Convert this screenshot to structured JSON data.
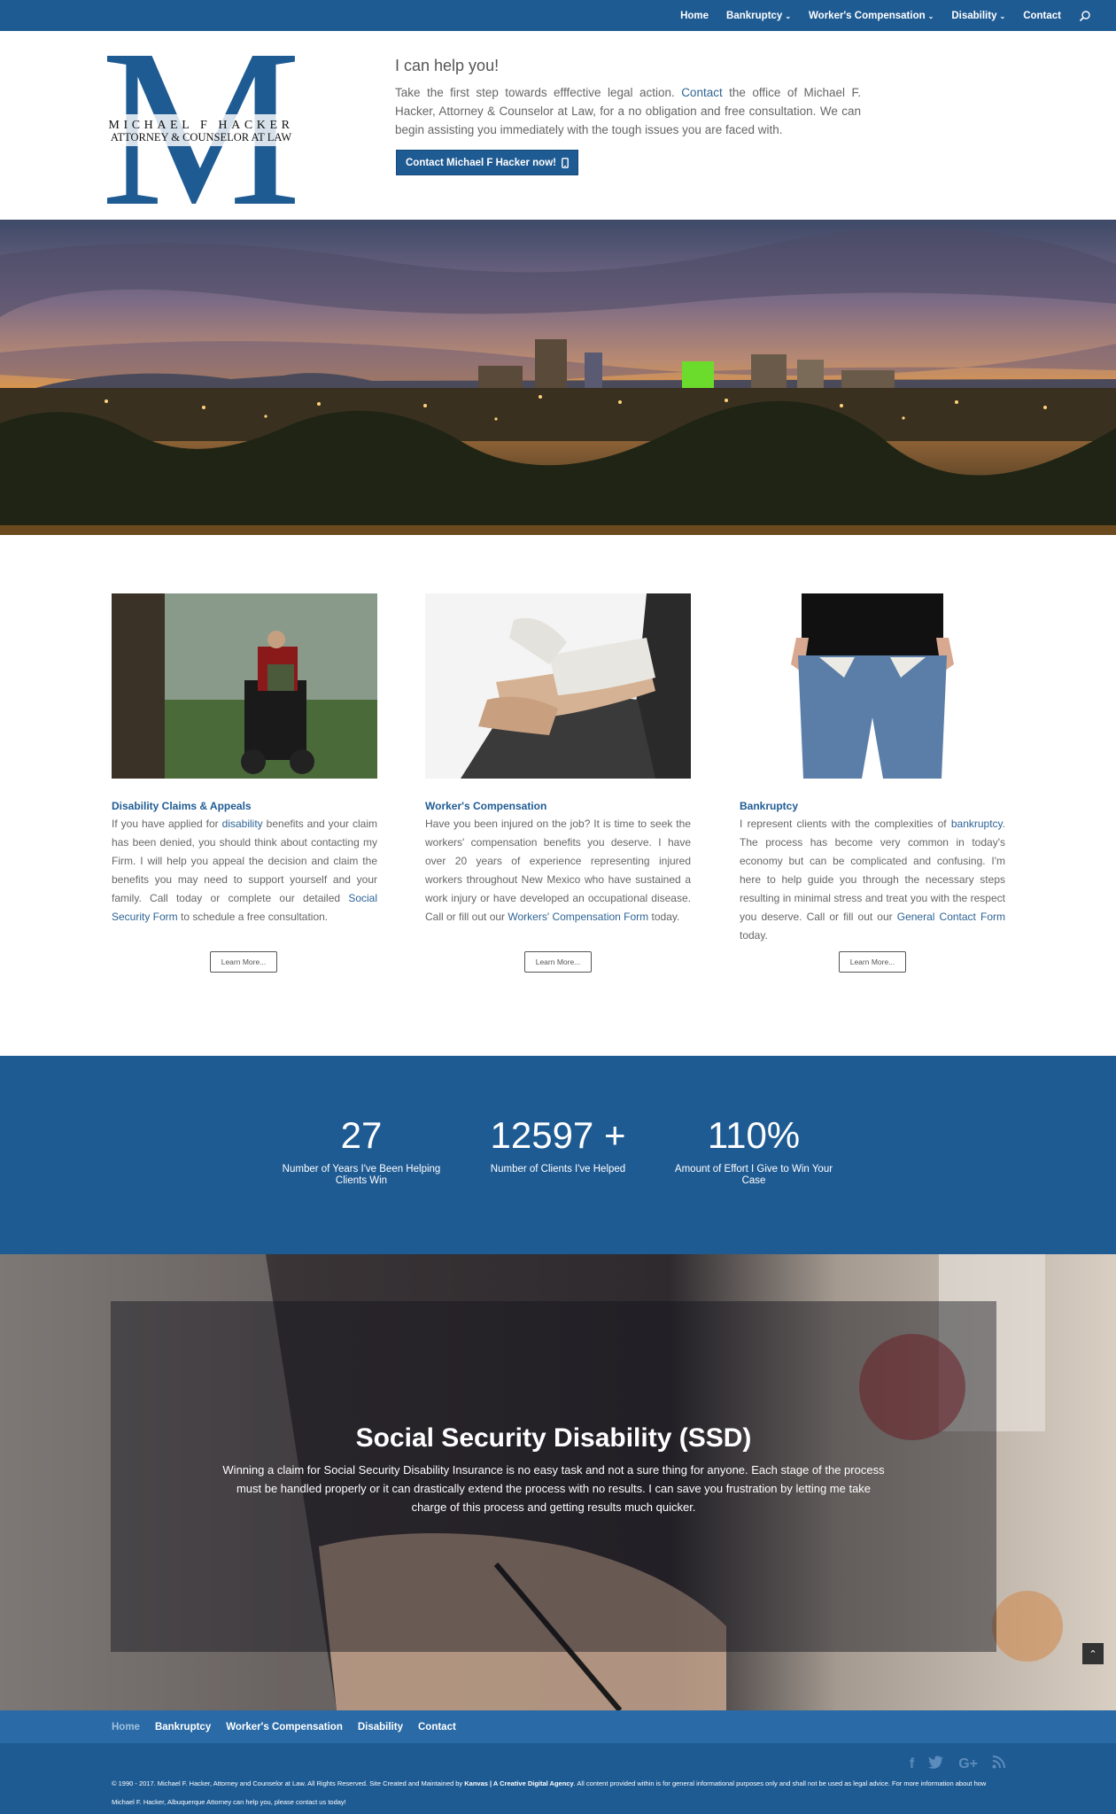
{
  "nav": {
    "items": [
      {
        "label": "Home",
        "dropdown": false
      },
      {
        "label": "Bankruptcy",
        "dropdown": true
      },
      {
        "label": "Worker's Compensation",
        "dropdown": true
      },
      {
        "label": "Disability",
        "dropdown": true
      },
      {
        "label": "Contact",
        "dropdown": false
      }
    ]
  },
  "logo": {
    "monogram": "M",
    "line1": "MICHAEL F HACKER",
    "line2": "ATTORNEY & COUNSELOR AT LAW"
  },
  "intro": {
    "heading": "I can help you!",
    "text_before_link": "Take the first step towards efffective legal action. ",
    "link": "Contact",
    "text_after_link": " the office of Michael F. Hacker, Attorney & Counselor at Law, for a no obligation and free consultation. We can begin assisting you immediately with the tough issues you are faced with.",
    "cta_label": "Contact Michael F Hacker now!"
  },
  "services": [
    {
      "title": "Disability Claims & Appeals",
      "p1": "If you have applied for ",
      "l1": "disability",
      "p2": " benefits and your claim has been denied, you should think about contacting my Firm.  I will help you appeal the decision and claim the benefits you may need to support yourself and your family.  Call today or complete our detailed ",
      "l2": "Social Security Form",
      "p3": " to schedule a free consultation.",
      "button": "Learn More..."
    },
    {
      "title": "Worker's Compensation",
      "p1": "Have you been injured on the job? It is time to seek the workers' compensation benefits you deserve.  I have over 20 years of experience representing injured workers throughout New Mexico who have sustained a work injury or have developed an occupational disease.  Call or fill out our ",
      "l1": "Workers' Compensation Form",
      "p2": " today.",
      "button": "Learn More..."
    },
    {
      "title": "Bankruptcy",
      "p1": "I represent clients with the complexities of ",
      "l1": "bankruptcy",
      "p2": ".  The process has become very common in today's economy but can be complicated and confusing.  I'm here to help guide you through the necessary steps resulting in minimal stress and treat you with the respect you deserve.  Call or fill out our ",
      "l2": "General Contact Form",
      "p3": " today.",
      "button": "Learn More..."
    }
  ],
  "stats": [
    {
      "value": "27",
      "label": "Number of Years I've Been Helping Clients Win"
    },
    {
      "value": "12597 +",
      "label": "Number of Clients I've Helped"
    },
    {
      "value": "110%",
      "label": "Amount of Effort I Give to Win Your Case"
    }
  ],
  "ssd": {
    "title": "Social Security Disability (SSD)",
    "text": "Winning a claim for Social Security Disability Insurance is no easy task and not a sure thing for anyone.  Each stage of the process must be handled properly or it can drastically extend the process with no results.  I can save you frustration by letting me take charge of this process and getting results much quicker."
  },
  "footer": {
    "links": [
      "Home",
      "Bankruptcy",
      "Worker's Compensation",
      "Disability",
      "Contact"
    ],
    "social": [
      "f",
      "t",
      "G+",
      "rss"
    ],
    "copy_a": "© 1990 - 2017. Michael F. Hacker, Attorney and Counselor at Law. All Rights Reserved. Site Created and Maintained by ",
    "copy_b": "Kanvas | A Creative Digital Agency",
    "copy_c": ". All content provided within is for general informational purposes only and shall not be used as legal advice. For more information about how Michael F. Hacker, Albuquerque Attorney can help you, please contact us today!"
  },
  "colors": {
    "brand": "#1f5b93",
    "footer_nav": "#2a6aa6",
    "link": "#2e6496"
  },
  "icons": [
    "chevron-down-icon",
    "search-icon",
    "phone-icon",
    "chevron-up-icon",
    "facebook-icon",
    "twitter-icon",
    "google-plus-icon",
    "rss-icon"
  ]
}
